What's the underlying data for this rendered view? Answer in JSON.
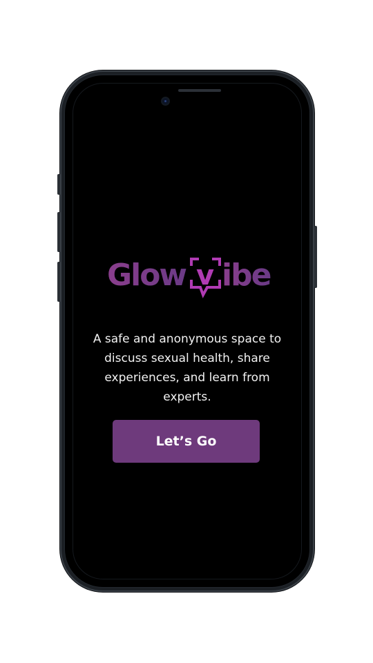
{
  "brand": {
    "name_part1": "Glow",
    "name_box_letter": "v",
    "name_part2": "ibe",
    "gradient_start": "#8a3e8c",
    "gradient_end": "#6a3a86",
    "accent": "#b03bb3"
  },
  "welcome": {
    "tagline": "A safe and anonymous space to discuss sexual health, share experiences, and learn from experts.",
    "cta_label": "Let’s Go"
  },
  "colors": {
    "screen_background": "#000000",
    "button_background": "#6e3a7c",
    "text": "#f2f2f2"
  }
}
